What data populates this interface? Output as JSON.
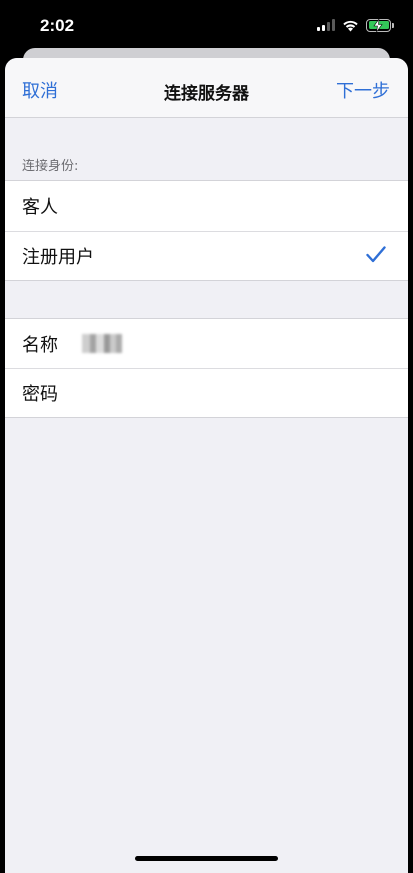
{
  "status_bar": {
    "time": "2:02"
  },
  "nav": {
    "cancel": "取消",
    "title": "连接服务器",
    "next": "下一步"
  },
  "identity": {
    "header": "连接身份:",
    "options": [
      {
        "label": "客人",
        "selected": false
      },
      {
        "label": "注册用户",
        "selected": true
      }
    ]
  },
  "form": {
    "name_label": "名称",
    "password_label": "密码"
  },
  "colors": {
    "accent": "#2f6fd6",
    "background": "#f0f0f5",
    "battery": "#34c759"
  }
}
